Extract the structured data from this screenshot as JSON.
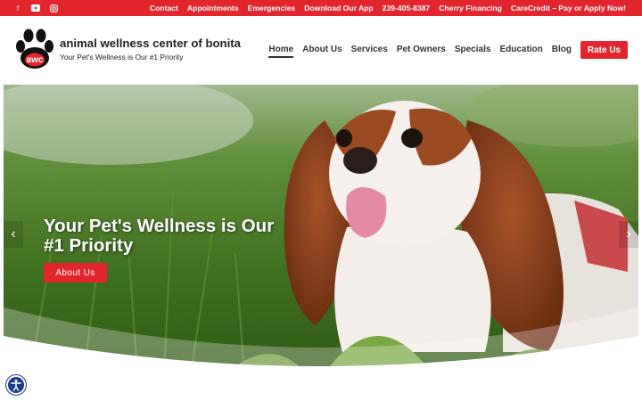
{
  "top_bar": {
    "background": "#e3262e",
    "social": [
      "facebook-icon",
      "youtube-icon",
      "instagram-icon"
    ],
    "links": [
      "Contact",
      "Appointments",
      "Emergencies",
      "Download Our App",
      "239-405-8387",
      "Cherry Financing",
      "CareCredit – Pay or Apply Now!"
    ]
  },
  "header": {
    "logo_text": "awc",
    "name": "animal wellness center of bonita",
    "tagline": "Your Pet's Wellness is Our #1 Priority"
  },
  "nav": {
    "items": [
      "Home",
      "About Us",
      "Services",
      "Pet Owners",
      "Specials",
      "Education",
      "Blog"
    ],
    "active": "Home",
    "cta": "Rate Us"
  },
  "hero": {
    "title": "Your Pet's Wellness is Our #1 Priority",
    "button": "About Us"
  },
  "colors": {
    "accent": "#e3262e",
    "accessibility": "#1f3c8b"
  }
}
